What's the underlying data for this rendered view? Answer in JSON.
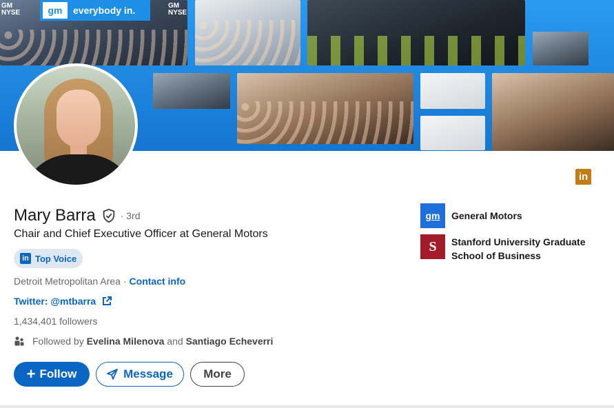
{
  "banner": {
    "sign_text": "everybody in.",
    "gm_logo": "gm",
    "gm_nyse": [
      "GM",
      "NYSE"
    ]
  },
  "profile": {
    "name": "Mary Barra",
    "degree": "· 3rd",
    "headline": "Chair and Chief Executive Officer at General Motors",
    "badge": "Top Voice",
    "location": "Detroit Metropolitan Area",
    "location_sep": "·",
    "contact_info": "Contact info",
    "twitter": "Twitter: @mtbarra",
    "followers": "1,434,401 followers",
    "followed_by": {
      "prefix": "Followed by ",
      "person1": "Evelina Milenova",
      "joiner": " and ",
      "person2": "Santiago Echeverri"
    }
  },
  "actions": {
    "follow": "Follow",
    "message": "Message",
    "more": "More"
  },
  "organizations": [
    {
      "name": "General Motors",
      "logo_text": "gm"
    },
    {
      "name": "Stanford University Graduate School of Business",
      "logo_text": "S"
    }
  ],
  "linkedin_badge": "in",
  "colors": {
    "primary": "#0a66c2",
    "banner_blue": "#1b8de2",
    "linkedin_gold": "#c37d16",
    "gm_blue": "#1e6fd9",
    "stanford_red": "#a31c2b"
  },
  "icons": [
    "verified-shield-icon",
    "external-link-icon",
    "people-icon",
    "plus-icon",
    "send-icon",
    "linkedin-icon"
  ]
}
